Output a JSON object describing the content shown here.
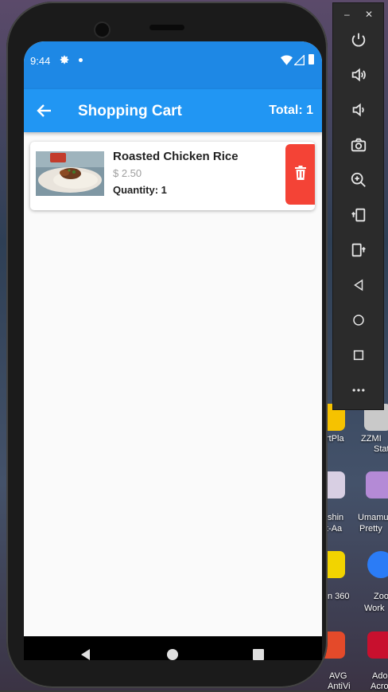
{
  "status_bar": {
    "time": "9:44"
  },
  "app_bar": {
    "title": "Shopping Cart",
    "total": "Total: 1"
  },
  "cart_items": [
    {
      "name": "Roasted Chicken Rice",
      "price": "$ 2.50",
      "quantity": "Quantity: 1"
    }
  ],
  "emulator_toolbar": {
    "buttons": [
      "power-icon",
      "volume-up-icon",
      "volume-down-icon",
      "camera-icon",
      "zoom-icon",
      "rotate-left-icon",
      "rotate-right-icon",
      "back-icon",
      "home-icon",
      "overview-icon",
      "more-icon"
    ]
  },
  "desktop_labels": [
    "ZZMI",
    "Stat",
    "Umamu",
    "Pretty",
    "Zoo",
    "Work",
    "AVG",
    "AntiVi",
    "Ado",
    "Acro",
    "rtPla",
    "shin",
    "t-Aa",
    "n 360"
  ],
  "colors": {
    "primary": "#2196f3",
    "status_bar": "#1e88e5",
    "delete": "#f44336"
  }
}
